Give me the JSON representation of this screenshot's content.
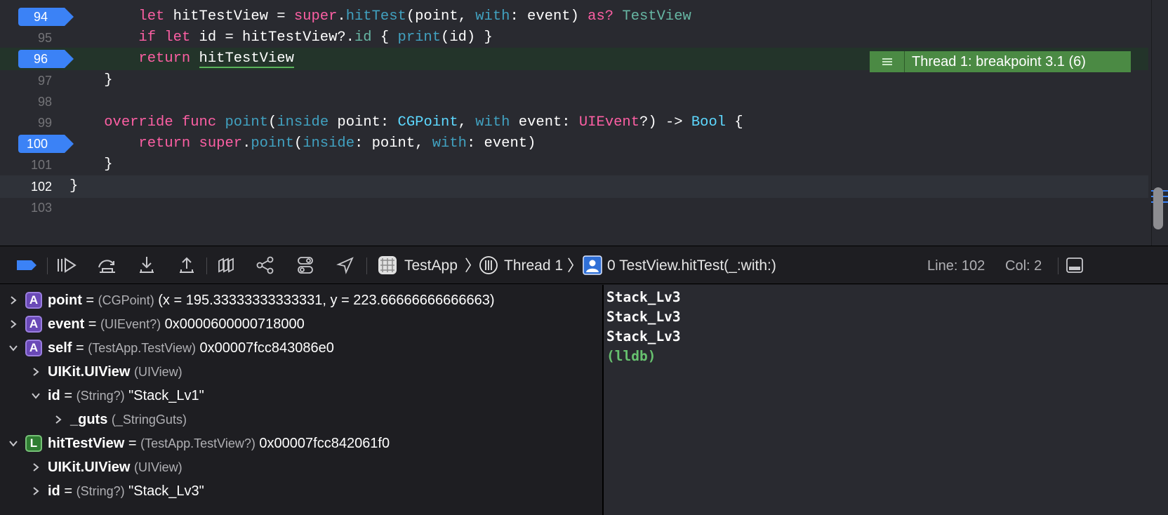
{
  "editor": {
    "lines": [
      {
        "num": "94",
        "breakpoint": true,
        "tokens": [
          [
            "",
            "        "
          ],
          [
            "kw",
            "let"
          ],
          [
            "",
            " hitTestView = "
          ],
          [
            "kw",
            "super"
          ],
          [
            "",
            "."
          ],
          [
            "fnb",
            "hitTest"
          ],
          [
            "",
            "(point, "
          ],
          [
            "fnb",
            "with"
          ],
          [
            "",
            ": event) "
          ],
          [
            "kw",
            "as?"
          ],
          [
            "",
            " "
          ],
          [
            "fn",
            "TestView"
          ]
        ]
      },
      {
        "num": "95",
        "breakpoint": false,
        "tokens": [
          [
            "",
            "        "
          ],
          [
            "kw",
            "if"
          ],
          [
            "",
            " "
          ],
          [
            "kw",
            "let"
          ],
          [
            "",
            " id = hitTestView?."
          ],
          [
            "fn",
            "id"
          ],
          [
            "",
            " { "
          ],
          [
            "fnb",
            "print"
          ],
          [
            "",
            "(id) }"
          ]
        ]
      },
      {
        "num": "96",
        "breakpoint": true,
        "paused": true,
        "tokens": [
          [
            "",
            "        "
          ],
          [
            "kw",
            "return"
          ],
          [
            "",
            " "
          ],
          [
            "ul",
            "hitTestView"
          ]
        ]
      },
      {
        "num": "97",
        "breakpoint": false,
        "tokens": [
          [
            "",
            "    }"
          ]
        ]
      },
      {
        "num": "98",
        "breakpoint": false,
        "tokens": [
          [
            "",
            ""
          ]
        ]
      },
      {
        "num": "99",
        "breakpoint": false,
        "tokens": [
          [
            "",
            "    "
          ],
          [
            "kw",
            "override"
          ],
          [
            "",
            " "
          ],
          [
            "kw",
            "func"
          ],
          [
            "",
            " "
          ],
          [
            "fnb",
            "point"
          ],
          [
            "",
            "("
          ],
          [
            "fnb",
            "inside"
          ],
          [
            "",
            " point: "
          ],
          [
            "tyb",
            "CGPoint"
          ],
          [
            "",
            ", "
          ],
          [
            "fnb",
            "with"
          ],
          [
            "",
            " event: "
          ],
          [
            "kw",
            "UIEvent"
          ],
          [
            "",
            "?) -> "
          ],
          [
            "tyb",
            "Bool"
          ],
          [
            "",
            " {"
          ]
        ]
      },
      {
        "num": "100",
        "breakpoint": true,
        "tokens": [
          [
            "",
            "        "
          ],
          [
            "kw",
            "return"
          ],
          [
            "",
            " "
          ],
          [
            "kw",
            "super"
          ],
          [
            "",
            "."
          ],
          [
            "fnb",
            "point"
          ],
          [
            "",
            "("
          ],
          [
            "fnb",
            "inside"
          ],
          [
            "",
            ": point, "
          ],
          [
            "fnb",
            "with"
          ],
          [
            "",
            ": event)"
          ]
        ]
      },
      {
        "num": "101",
        "breakpoint": false,
        "tokens": [
          [
            "",
            "    }"
          ]
        ]
      },
      {
        "num": "102",
        "breakpoint": false,
        "current": true,
        "tokens": [
          [
            "",
            "}"
          ]
        ]
      },
      {
        "num": "103",
        "breakpoint": false,
        "tokens": [
          [
            "",
            ""
          ]
        ]
      }
    ],
    "thread_annotation": "Thread 1: breakpoint 3.1 (6)"
  },
  "debug_bar": {
    "crumb_app": "TestApp",
    "crumb_thread": "Thread 1",
    "crumb_frame": "0 TestView.hitTest(_:with:)",
    "line_label": "Line: 102",
    "col_label": "Col: 2",
    "icons": [
      "breakpoints-toggle-icon",
      "continue-icon",
      "step-over-icon",
      "step-into-icon",
      "step-out-icon",
      "view-hierarchy-icon",
      "memory-graph-icon",
      "environment-overrides-icon",
      "simulate-location-icon"
    ]
  },
  "variables": [
    {
      "badge": "A",
      "name": "point",
      "type": "(CGPoint)",
      "value": "(x = 195.33333333333331, y = 223.66666666666663)",
      "expanded": false,
      "indent": 0
    },
    {
      "badge": "A",
      "name": "event",
      "type": "(UIEvent?)",
      "value": "0x0000600000718000",
      "expanded": false,
      "indent": 0
    },
    {
      "badge": "A",
      "name": "self",
      "type": "(TestApp.TestView)",
      "value": "0x00007fcc843086e0",
      "expanded": true,
      "indent": 0
    },
    {
      "badge": "",
      "name": "UIKit.UIView",
      "type": "(UIView)",
      "value": "",
      "expanded": false,
      "indent": 1
    },
    {
      "badge": "",
      "name": "id",
      "type": "(String?)",
      "value": "\"Stack_Lv1\"",
      "expanded": true,
      "indent": 1
    },
    {
      "badge": "",
      "name": "_guts",
      "type": "(_StringGuts)",
      "value": "",
      "expanded": false,
      "indent": 2
    },
    {
      "badge": "L",
      "name": "hitTestView",
      "type": "(TestApp.TestView?)",
      "value": "0x00007fcc842061f0",
      "expanded": true,
      "indent": 0
    },
    {
      "badge": "",
      "name": "UIKit.UIView",
      "type": "(UIView)",
      "value": "",
      "expanded": false,
      "indent": 1
    },
    {
      "badge": "",
      "name": "id",
      "type": "(String?)",
      "value": "\"Stack_Lv3\"",
      "expanded": false,
      "indent": 1
    }
  ],
  "console": {
    "lines": [
      "Stack_Lv3",
      "Stack_Lv3",
      "Stack_Lv3"
    ],
    "prompt": "(lldb)"
  },
  "colors": {
    "breakpoint": "#3b82f6",
    "thread_badge": "#4b8a44",
    "keyword": "#fc5fa3",
    "prompt": "#67c16f"
  }
}
